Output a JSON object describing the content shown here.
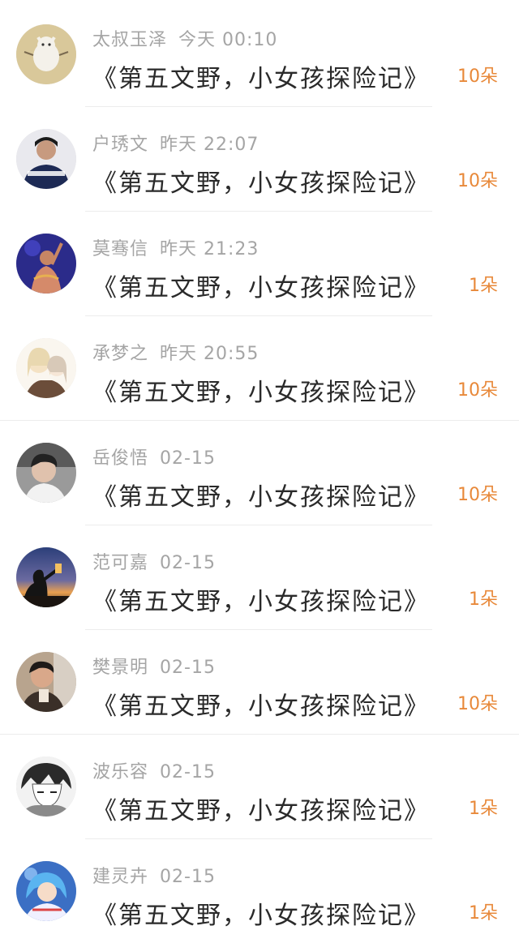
{
  "colors": {
    "name_gray": "#a5a5a5",
    "title_dark": "#2a2a2a",
    "count_orange": "#e8893a",
    "divider": "#ececec"
  },
  "entries": [
    {
      "name": "太叔玉泽",
      "time": "今天 00:10",
      "work": "《第五文野，小女孩探险记》",
      "count": "10朵",
      "avatar": "cartoon-cat-avatar"
    },
    {
      "name": "户琇文",
      "time": "昨天 22:07",
      "work": "《第五文野，小女孩探险记》",
      "count": "10朵",
      "avatar": "person-avatar"
    },
    {
      "name": "莫骞信",
      "time": "昨天 21:23",
      "work": "《第五文野，小女孩探险记》",
      "count": "1朵",
      "avatar": "singer-avatar"
    },
    {
      "name": "承梦之",
      "time": "昨天 20:55",
      "work": "《第五文野，小女孩探险记》",
      "count": "10朵",
      "avatar": "anime-girls-avatar"
    },
    {
      "name": "岳俊悟",
      "time": "02-15",
      "work": "《第五文野，小女孩探险记》",
      "count": "10朵",
      "avatar": "person-avatar"
    },
    {
      "name": "范可嘉",
      "time": "02-15",
      "work": "《第五文野，小女孩探险记》",
      "count": "1朵",
      "avatar": "sunset-silhouette-avatar"
    },
    {
      "name": "樊景明",
      "time": "02-15",
      "work": "《第五文野，小女孩探险记》",
      "count": "10朵",
      "avatar": "person-avatar"
    },
    {
      "name": "波乐容",
      "time": "02-15",
      "work": "《第五文野，小女孩探险记》",
      "count": "1朵",
      "avatar": "manga-boy-avatar"
    },
    {
      "name": "建灵卉",
      "time": "02-15",
      "work": "《第五文野，小女孩探险记》",
      "count": "1朵",
      "avatar": "anime-character-avatar"
    }
  ]
}
